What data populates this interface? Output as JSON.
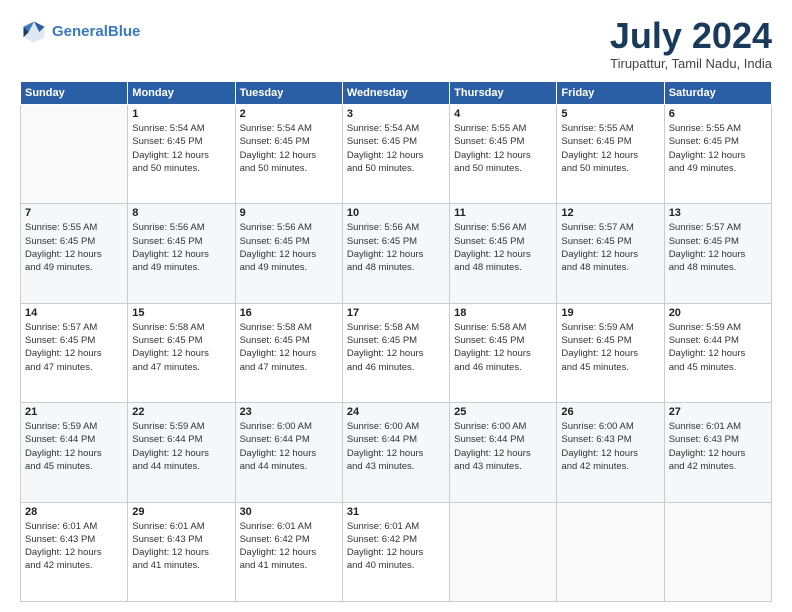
{
  "header": {
    "logo_line1": "General",
    "logo_line2": "Blue",
    "month": "July 2024",
    "location": "Tirupattur, Tamil Nadu, India"
  },
  "weekdays": [
    "Sunday",
    "Monday",
    "Tuesday",
    "Wednesday",
    "Thursday",
    "Friday",
    "Saturday"
  ],
  "weeks": [
    [
      {
        "day": "",
        "info": ""
      },
      {
        "day": "1",
        "info": "Sunrise: 5:54 AM\nSunset: 6:45 PM\nDaylight: 12 hours\nand 50 minutes."
      },
      {
        "day": "2",
        "info": "Sunrise: 5:54 AM\nSunset: 6:45 PM\nDaylight: 12 hours\nand 50 minutes."
      },
      {
        "day": "3",
        "info": "Sunrise: 5:54 AM\nSunset: 6:45 PM\nDaylight: 12 hours\nand 50 minutes."
      },
      {
        "day": "4",
        "info": "Sunrise: 5:55 AM\nSunset: 6:45 PM\nDaylight: 12 hours\nand 50 minutes."
      },
      {
        "day": "5",
        "info": "Sunrise: 5:55 AM\nSunset: 6:45 PM\nDaylight: 12 hours\nand 50 minutes."
      },
      {
        "day": "6",
        "info": "Sunrise: 5:55 AM\nSunset: 6:45 PM\nDaylight: 12 hours\nand 49 minutes."
      }
    ],
    [
      {
        "day": "7",
        "info": "Sunrise: 5:55 AM\nSunset: 6:45 PM\nDaylight: 12 hours\nand 49 minutes."
      },
      {
        "day": "8",
        "info": "Sunrise: 5:56 AM\nSunset: 6:45 PM\nDaylight: 12 hours\nand 49 minutes."
      },
      {
        "day": "9",
        "info": "Sunrise: 5:56 AM\nSunset: 6:45 PM\nDaylight: 12 hours\nand 49 minutes."
      },
      {
        "day": "10",
        "info": "Sunrise: 5:56 AM\nSunset: 6:45 PM\nDaylight: 12 hours\nand 48 minutes."
      },
      {
        "day": "11",
        "info": "Sunrise: 5:56 AM\nSunset: 6:45 PM\nDaylight: 12 hours\nand 48 minutes."
      },
      {
        "day": "12",
        "info": "Sunrise: 5:57 AM\nSunset: 6:45 PM\nDaylight: 12 hours\nand 48 minutes."
      },
      {
        "day": "13",
        "info": "Sunrise: 5:57 AM\nSunset: 6:45 PM\nDaylight: 12 hours\nand 48 minutes."
      }
    ],
    [
      {
        "day": "14",
        "info": "Sunrise: 5:57 AM\nSunset: 6:45 PM\nDaylight: 12 hours\nand 47 minutes."
      },
      {
        "day": "15",
        "info": "Sunrise: 5:58 AM\nSunset: 6:45 PM\nDaylight: 12 hours\nand 47 minutes."
      },
      {
        "day": "16",
        "info": "Sunrise: 5:58 AM\nSunset: 6:45 PM\nDaylight: 12 hours\nand 47 minutes."
      },
      {
        "day": "17",
        "info": "Sunrise: 5:58 AM\nSunset: 6:45 PM\nDaylight: 12 hours\nand 46 minutes."
      },
      {
        "day": "18",
        "info": "Sunrise: 5:58 AM\nSunset: 6:45 PM\nDaylight: 12 hours\nand 46 minutes."
      },
      {
        "day": "19",
        "info": "Sunrise: 5:59 AM\nSunset: 6:45 PM\nDaylight: 12 hours\nand 45 minutes."
      },
      {
        "day": "20",
        "info": "Sunrise: 5:59 AM\nSunset: 6:44 PM\nDaylight: 12 hours\nand 45 minutes."
      }
    ],
    [
      {
        "day": "21",
        "info": "Sunrise: 5:59 AM\nSunset: 6:44 PM\nDaylight: 12 hours\nand 45 minutes."
      },
      {
        "day": "22",
        "info": "Sunrise: 5:59 AM\nSunset: 6:44 PM\nDaylight: 12 hours\nand 44 minutes."
      },
      {
        "day": "23",
        "info": "Sunrise: 6:00 AM\nSunset: 6:44 PM\nDaylight: 12 hours\nand 44 minutes."
      },
      {
        "day": "24",
        "info": "Sunrise: 6:00 AM\nSunset: 6:44 PM\nDaylight: 12 hours\nand 43 minutes."
      },
      {
        "day": "25",
        "info": "Sunrise: 6:00 AM\nSunset: 6:44 PM\nDaylight: 12 hours\nand 43 minutes."
      },
      {
        "day": "26",
        "info": "Sunrise: 6:00 AM\nSunset: 6:43 PM\nDaylight: 12 hours\nand 42 minutes."
      },
      {
        "day": "27",
        "info": "Sunrise: 6:01 AM\nSunset: 6:43 PM\nDaylight: 12 hours\nand 42 minutes."
      }
    ],
    [
      {
        "day": "28",
        "info": "Sunrise: 6:01 AM\nSunset: 6:43 PM\nDaylight: 12 hours\nand 42 minutes."
      },
      {
        "day": "29",
        "info": "Sunrise: 6:01 AM\nSunset: 6:43 PM\nDaylight: 12 hours\nand 41 minutes."
      },
      {
        "day": "30",
        "info": "Sunrise: 6:01 AM\nSunset: 6:42 PM\nDaylight: 12 hours\nand 41 minutes."
      },
      {
        "day": "31",
        "info": "Sunrise: 6:01 AM\nSunset: 6:42 PM\nDaylight: 12 hours\nand 40 minutes."
      },
      {
        "day": "",
        "info": ""
      },
      {
        "day": "",
        "info": ""
      },
      {
        "day": "",
        "info": ""
      }
    ]
  ]
}
